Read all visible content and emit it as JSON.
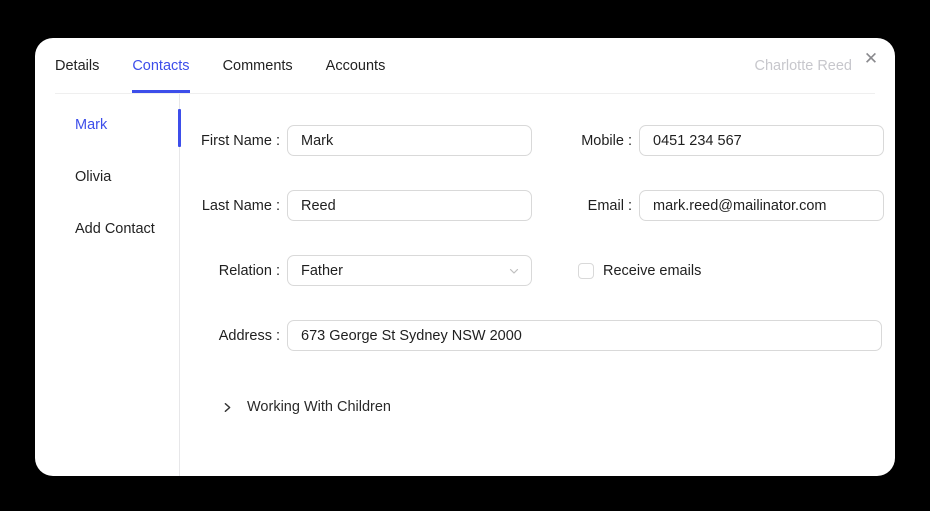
{
  "colors": {
    "accent": "#3d4eea",
    "muted_text": "#c7c7cc"
  },
  "modal": {
    "header_user": "Charlotte Reed",
    "close_icon": "✕",
    "tabs": [
      {
        "label": "Details",
        "active": false
      },
      {
        "label": "Contacts",
        "active": true
      },
      {
        "label": "Comments",
        "active": false
      },
      {
        "label": "Accounts",
        "active": false
      }
    ]
  },
  "sidebar": {
    "items": [
      {
        "label": "Mark",
        "active": true
      },
      {
        "label": "Olivia",
        "active": false
      },
      {
        "label": "Add Contact",
        "active": false
      }
    ]
  },
  "form": {
    "first_name": {
      "label": "First Name :",
      "value": "Mark"
    },
    "mobile": {
      "label": "Mobile :",
      "value": "0451 234 567"
    },
    "last_name": {
      "label": "Last Name :",
      "value": "Reed"
    },
    "email": {
      "label": "Email :",
      "value": "mark.reed@mailinator.com"
    },
    "relation": {
      "label": "Relation :",
      "value": "Father"
    },
    "receive_emails": {
      "label": "Receive emails",
      "checked": false
    },
    "address": {
      "label": "Address :",
      "value": "673 George St Sydney NSW 2000"
    },
    "working_with_children": {
      "label": "Working With Children",
      "expanded": false
    }
  }
}
